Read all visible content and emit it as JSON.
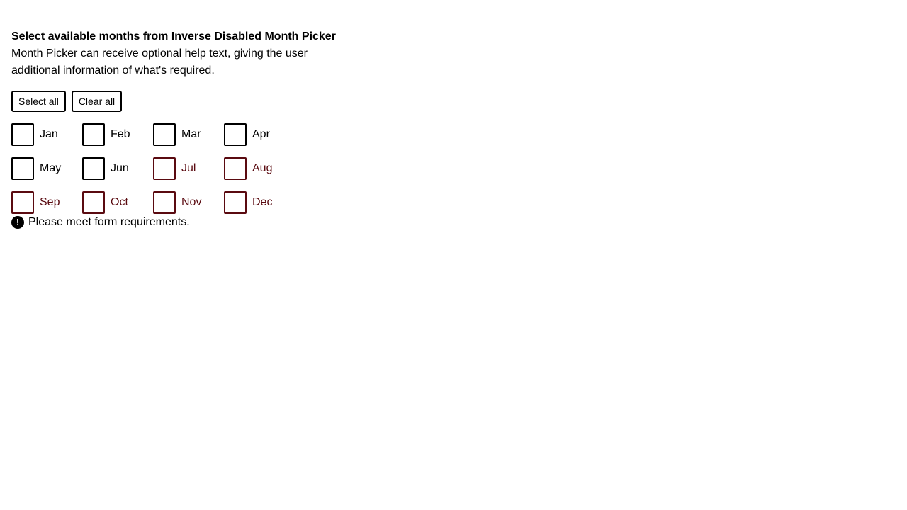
{
  "picker": {
    "title": "Select available months from Inverse Disabled Month Picker",
    "help_text": "Month Picker can receive optional help text, giving the user additional information of what's required.",
    "select_all_label": "Select all",
    "clear_all_label": "Clear all",
    "months": [
      {
        "label": "Jan",
        "disabled": false,
        "checked": false
      },
      {
        "label": "Feb",
        "disabled": false,
        "checked": false
      },
      {
        "label": "Mar",
        "disabled": false,
        "checked": false
      },
      {
        "label": "Apr",
        "disabled": false,
        "checked": false
      },
      {
        "label": "May",
        "disabled": false,
        "checked": false
      },
      {
        "label": "Jun",
        "disabled": false,
        "checked": false
      },
      {
        "label": "Jul",
        "disabled": true,
        "checked": false
      },
      {
        "label": "Aug",
        "disabled": true,
        "checked": false
      },
      {
        "label": "Sep",
        "disabled": true,
        "checked": false
      },
      {
        "label": "Oct",
        "disabled": true,
        "checked": false
      },
      {
        "label": "Nov",
        "disabled": true,
        "checked": false
      },
      {
        "label": "Dec",
        "disabled": true,
        "checked": false
      }
    ],
    "error_icon": "exclamation-circle-icon",
    "error_text": "Please meet form requirements."
  },
  "colors": {
    "disabled": "#5a0a10",
    "border": "#000000"
  }
}
